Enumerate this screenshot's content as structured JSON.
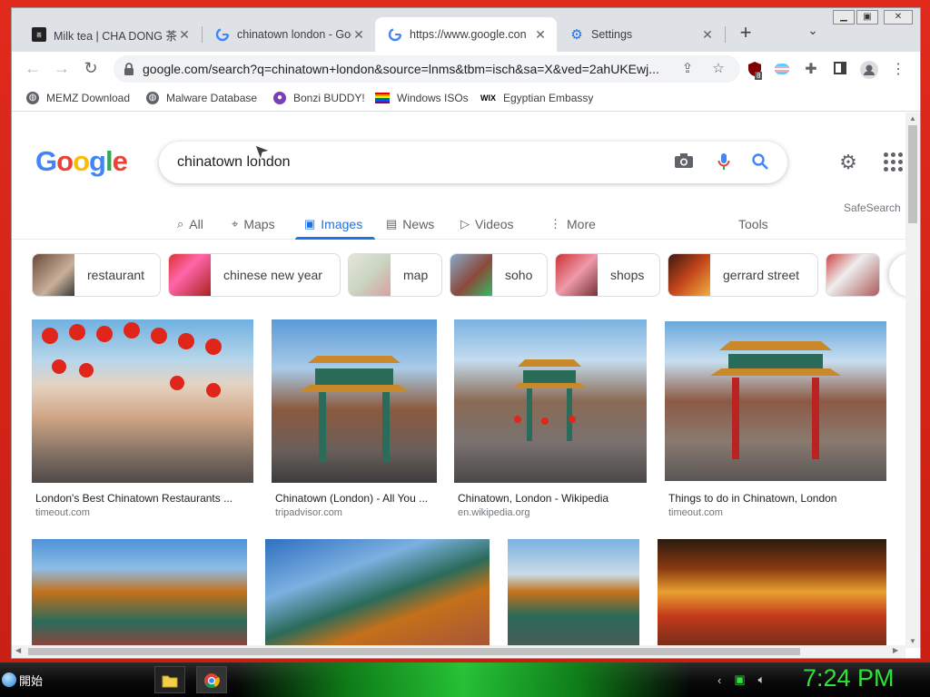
{
  "browser": {
    "tabs": [
      {
        "label": "Milk tea | CHA DONG 茶",
        "icon": "cha-dong-favicon"
      },
      {
        "label": "chinatown london - Goo",
        "icon": "google-g-icon"
      },
      {
        "label": "https://www.google.con",
        "icon": "google-g-icon",
        "active": true
      },
      {
        "label": "Settings",
        "icon": "settings-gear-icon"
      }
    ],
    "new_tab_symbol": "+",
    "tab_search_symbol": "⌄",
    "close_symbol": "✕",
    "url": "google.com/search?q=chinatown+london&source=lnms&tbm=isch&sa=X&ved=2ahUKEwj...",
    "extension_badge": "8",
    "bookmarks": [
      {
        "label": "MEMZ Download",
        "icon": "globe-icon"
      },
      {
        "label": "Malware Database",
        "icon": "globe-icon"
      },
      {
        "label": "Bonzi BUDDY!",
        "icon": "bonzi-icon"
      },
      {
        "label": "Windows ISOs",
        "icon": "rainbow-flag-icon"
      },
      {
        "label": "Egyptian Embassy",
        "icon": "wix-icon",
        "prefix": "WIX"
      }
    ]
  },
  "google": {
    "logo": [
      "G",
      "o",
      "o",
      "g",
      "l",
      "e"
    ],
    "query": "chinatown london",
    "safesearch": "SafeSearch",
    "tabs": [
      {
        "label": "All",
        "icon": "search-icon"
      },
      {
        "label": "Maps",
        "icon": "map-pin-icon"
      },
      {
        "label": "Images",
        "icon": "image-icon",
        "active": true
      },
      {
        "label": "News",
        "icon": "news-icon"
      },
      {
        "label": "Videos",
        "icon": "video-icon"
      },
      {
        "label": "More",
        "icon": "more-vert-icon"
      }
    ],
    "tools": "Tools",
    "chips": [
      "restaurant",
      "chinese new year",
      "map",
      "soho",
      "shops",
      "gerrard street"
    ],
    "results_row1": [
      {
        "title": "London's Best Chinatown Restaurants ...",
        "source": "timeout.com"
      },
      {
        "title": "Chinatown (London) - All You ...",
        "source": "tripadvisor.com"
      },
      {
        "title": "Chinatown, London - Wikipedia",
        "source": "en.wikipedia.org"
      },
      {
        "title": "Things to do in Chinatown, London",
        "source": "timeout.com"
      }
    ]
  },
  "taskbar": {
    "start_label": "開始",
    "clock": "7:24 PM"
  },
  "colors": {
    "google_blue": "#4285f4",
    "google_red": "#ea4335",
    "google_yellow": "#fbbc05",
    "google_green": "#34a853",
    "link_active": "#1a73e8",
    "desktop": "#d8261a",
    "clock": "#2fe23a"
  }
}
